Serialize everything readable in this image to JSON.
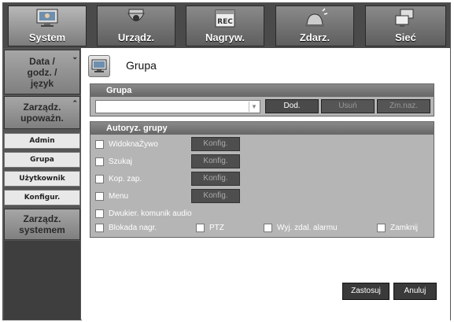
{
  "tabs": [
    {
      "label": "System",
      "icon": "monitor-icon"
    },
    {
      "label": "Urządz.",
      "icon": "camera-icon"
    },
    {
      "label": "Nagryw.",
      "icon": "rec-calendar-icon"
    },
    {
      "label": "Zdarz.",
      "icon": "alarm-icon"
    },
    {
      "label": "Sieć",
      "icon": "network-icon"
    }
  ],
  "sidebar": {
    "groups": [
      {
        "label": "Data / godz. / język"
      },
      {
        "label": "Zarządz. upoważn."
      },
      {
        "label": "Zarządz. systemem"
      }
    ],
    "items": [
      {
        "label": "Admin"
      },
      {
        "label": "Grupa"
      },
      {
        "label": "Użytkownik"
      },
      {
        "label": "Konfigur."
      }
    ]
  },
  "page": {
    "title": "Grupa"
  },
  "group_panel": {
    "header": "Grupa",
    "select_value": "",
    "buttons": {
      "add": "Dod.",
      "delete": "Usuń",
      "rename": "Zm.naz."
    }
  },
  "auth_panel": {
    "header": "Autoryz. grupy",
    "perms": [
      {
        "label": "WidoknaŻywo",
        "konfig": "Konfig."
      },
      {
        "label": "Szukaj",
        "konfig": "Konfig."
      },
      {
        "label": "Kop. zap.",
        "konfig": "Konfig."
      },
      {
        "label": "Menu",
        "konfig": "Konfig."
      },
      {
        "label": "Dwukier. komunik audio"
      }
    ],
    "options": [
      {
        "label": "Blokada nagr."
      },
      {
        "label": "PTZ"
      },
      {
        "label": "Wyj. zdal. alarmu"
      },
      {
        "label": "Zamknij"
      }
    ]
  },
  "footer": {
    "apply": "Zastosuj",
    "cancel": "Anuluj"
  }
}
